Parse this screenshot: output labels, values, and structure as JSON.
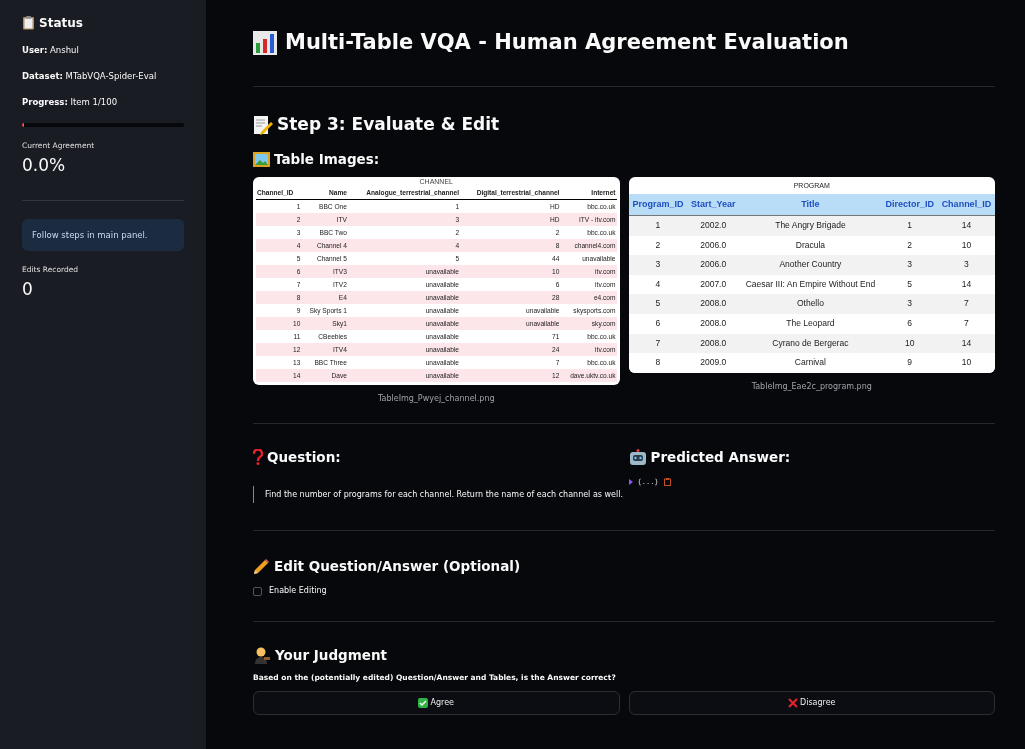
{
  "sidebar": {
    "title": "Status",
    "fields": [
      {
        "label": "User:",
        "value": "Anshul"
      },
      {
        "label": "Dataset:",
        "value": "MTabVQA-Spider-Eval"
      },
      {
        "label": "Progress:",
        "value": "Item 1/100"
      }
    ],
    "progress": {
      "level": 0.01
    },
    "agreement": {
      "label": "Current Agreement",
      "value": "0.0%"
    },
    "info": "Follow steps in main panel.",
    "edits": {
      "label": "Edits Recorded",
      "value": "0"
    }
  },
  "main": {
    "title": "Multi-Table VQA - Human Agreement Evaluation",
    "step_title": "Step 3: Evaluate & Edit",
    "images_title": "Table Images:",
    "tables": [
      {
        "kind": "channel",
        "title": "CHANNEL",
        "caption": "TableImg_Pwyej_channel.png",
        "columns": [
          "Channel_ID",
          "Name",
          "Analogue_terrestrial_channel",
          "Digital_terrestrial_channel",
          "Internet"
        ],
        "rows": [
          [
            "1",
            "BBC One",
            "1",
            "HD",
            "bbc.co.uk"
          ],
          [
            "2",
            "ITV",
            "3",
            "HD",
            "ITV - itv.com"
          ],
          [
            "3",
            "BBC Two",
            "2",
            "2",
            "bbc.co.uk"
          ],
          [
            "4",
            "Channel 4",
            "4",
            "8",
            "channel4.com"
          ],
          [
            "5",
            "Channel 5",
            "5",
            "44",
            "unavailable"
          ],
          [
            "6",
            "ITV3",
            "unavailable",
            "10",
            "itv.com"
          ],
          [
            "7",
            "ITV2",
            "unavailable",
            "6",
            "itv.com"
          ],
          [
            "8",
            "E4",
            "unavailable",
            "28",
            "e4.com"
          ],
          [
            "9",
            "Sky Sports 1",
            "unavailable",
            "unavailable",
            "skysports.com"
          ],
          [
            "10",
            "Sky1",
            "unavailable",
            "unavailable",
            "sky.com"
          ],
          [
            "11",
            "CBeebies",
            "unavailable",
            "71",
            "bbc.co.uk"
          ],
          [
            "12",
            "ITV4",
            "unavailable",
            "24",
            "itv.com"
          ],
          [
            "13",
            "BBC Three",
            "unavailable",
            "7",
            "bbc.co.uk"
          ],
          [
            "14",
            "Dave",
            "unavailable",
            "12",
            "dave.uktv.co.uk"
          ]
        ]
      },
      {
        "kind": "program",
        "title": "PROGRAM",
        "caption": "TableImg_Eae2c_program.png",
        "columns": [
          "Program_ID",
          "Start_Year",
          "Title",
          "Director_ID",
          "Channel_ID"
        ],
        "rows": [
          [
            "1",
            "2002.0",
            "The Angry Brigade",
            "1",
            "14"
          ],
          [
            "2",
            "2006.0",
            "Dracula",
            "2",
            "10"
          ],
          [
            "3",
            "2006.0",
            "Another Country",
            "3",
            "3"
          ],
          [
            "4",
            "2007.0",
            "Caesar III: An Empire Without End",
            "5",
            "14"
          ],
          [
            "5",
            "2008.0",
            "Othello",
            "3",
            "7"
          ],
          [
            "6",
            "2008.0",
            "The Leopard",
            "6",
            "7"
          ],
          [
            "7",
            "2008.0",
            "Cyrano de Bergerac",
            "10",
            "14"
          ],
          [
            "8",
            "2009.0",
            "Carnival",
            "9",
            "10"
          ]
        ]
      }
    ],
    "question": {
      "title": "Question:",
      "text": "Find the number of programs for each channel. Return the name of each channel as well."
    },
    "answer": {
      "title": "Predicted Answer:",
      "value": "{...}",
      "expanded": false
    },
    "edit": {
      "title": "Edit Question/Answer (Optional)",
      "checkbox": {
        "label": "Enable Editing",
        "checked": false
      }
    },
    "judgment": {
      "title": "Your Judgment",
      "prompt": "Based on the (potentially edited) Question/Answer and Tables, is the Answer correct?",
      "buttons": [
        {
          "kind": "agree",
          "label": "Agree"
        },
        {
          "kind": "disagree",
          "label": "Disagree"
        }
      ]
    }
  }
}
